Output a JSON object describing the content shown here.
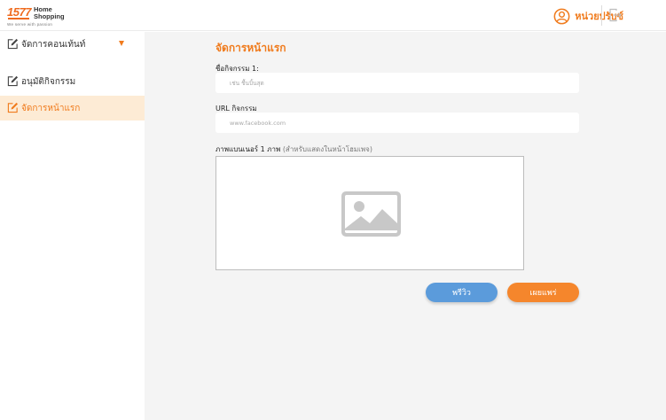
{
  "header": {
    "logo_number": "1577",
    "logo_name_line1": "Home",
    "logo_name_line2": "Shopping",
    "logo_tagline": "We serve with passion",
    "user_name": "หน่วยปรับซ์",
    "user_icon": "user-circle-icon",
    "logout_icon": "logout-icon"
  },
  "sidebar": {
    "items": [
      {
        "label": "จัดการคอนเท้นท์",
        "icon": "edit-icon",
        "has_dropdown": true,
        "active": false
      },
      {
        "label": "อนุมัติกิจกรรม",
        "icon": "edit-icon",
        "active": false
      },
      {
        "label": "จัดการหน้าแรก",
        "icon": "edit-icon",
        "active": true
      }
    ]
  },
  "main": {
    "title": "จัดการหน้าแรก",
    "field1_label": "ชื่อกิจกรรม 1:",
    "field1_placeholder": "เช่น ชื้นบิ้นสุด",
    "field2_label": "URL กิจกรรม",
    "field2_placeholder": "www.facebook.com",
    "image_label": "ภาพแบนเนอร์ 1 ภาพ",
    "image_note": "(สำหรับแสดงในหน้าโฮมเพจ)",
    "image_placeholder_icon": "image-placeholder-icon",
    "preview_button": "พรีวิว",
    "publish_button": "เผยแพร่"
  },
  "colors": {
    "accent": "#f07b1d",
    "active_bg": "#fdebd5",
    "preview_button": "#5b9bdb",
    "publish_button": "#f5862c",
    "content_bg": "#f4f4f4"
  }
}
